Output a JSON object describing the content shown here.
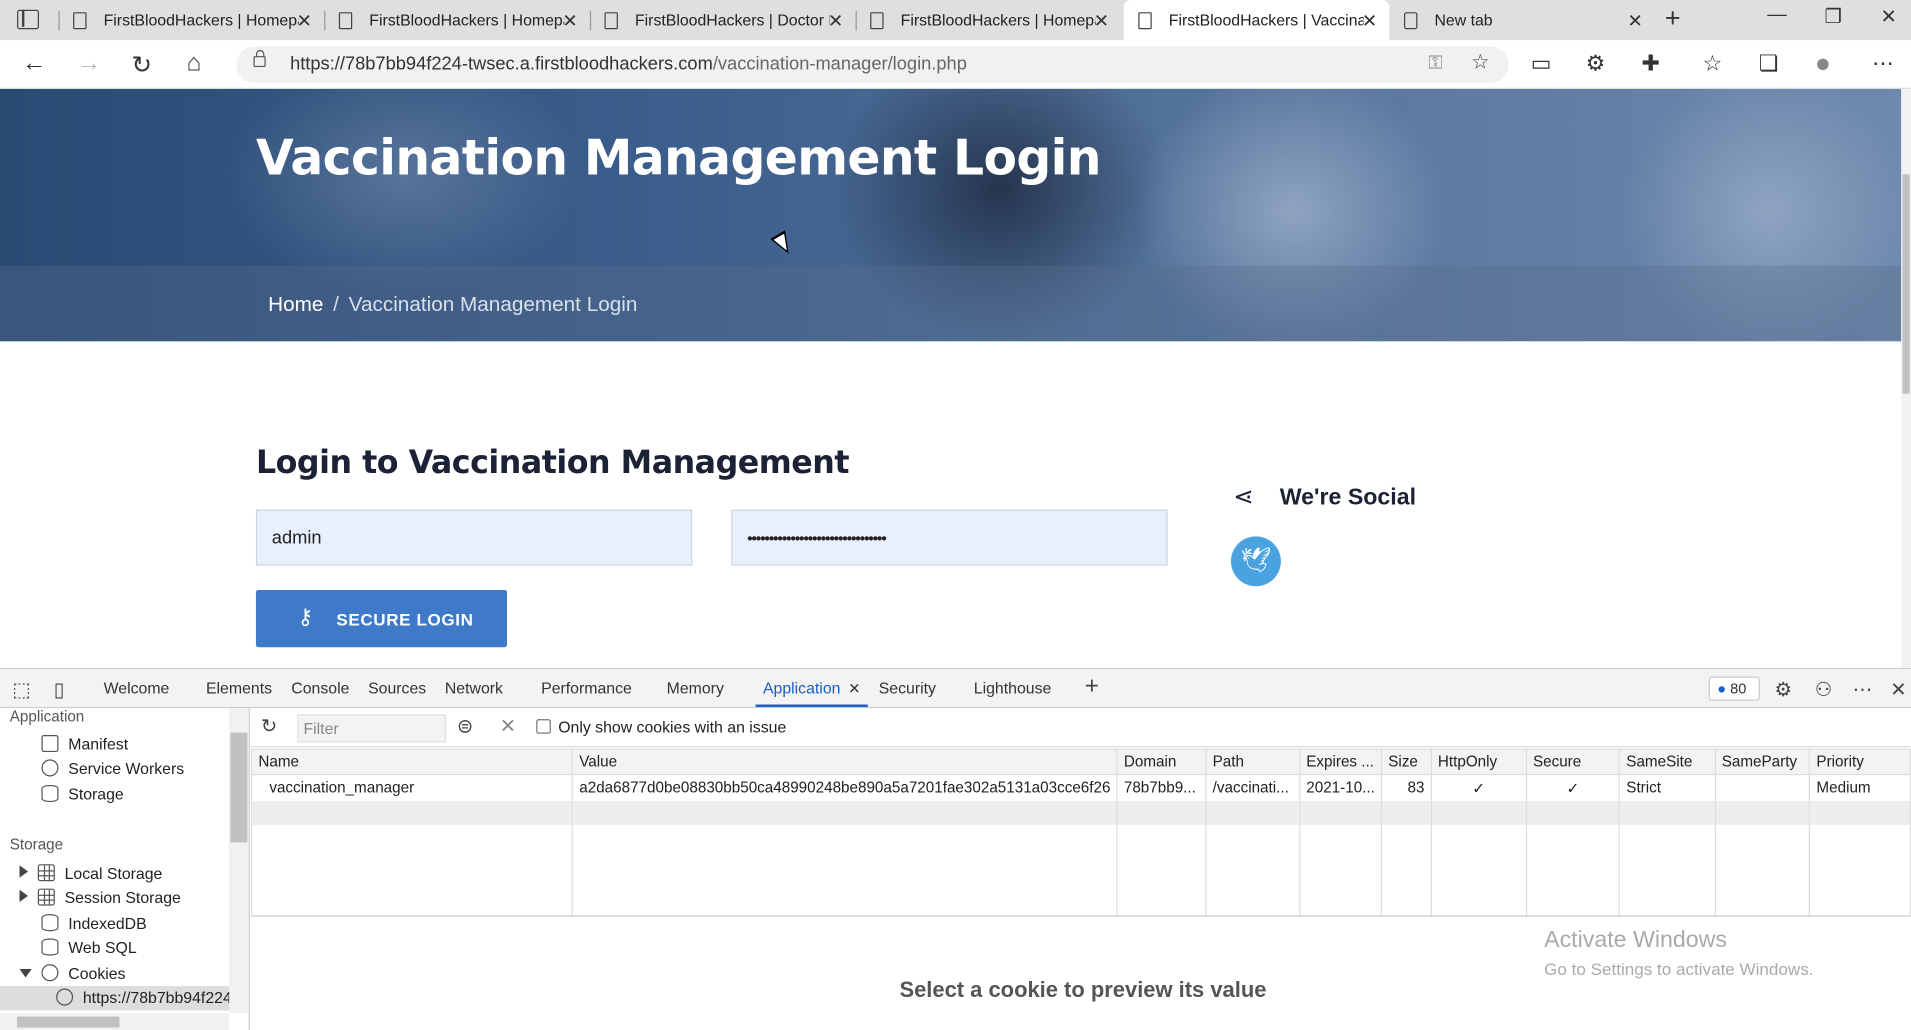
{
  "browser": {
    "tabs": [
      {
        "title": "FirstBloodHackers | Homepage"
      },
      {
        "title": "FirstBloodHackers | Homepage"
      },
      {
        "title": "FirstBloodHackers | Doctor Login"
      },
      {
        "title": "FirstBloodHackers | Homepage"
      },
      {
        "title": "FirstBloodHackers | Vaccination Management Login"
      },
      {
        "title": "New tab"
      }
    ],
    "url_host": "https://78b7bb94f224-twsec.a.firstbloodhackers.com",
    "url_path": "/vaccination-manager/login.php"
  },
  "page": {
    "hero_title": "Vaccination Management Login",
    "breadcrumb_home": "Home",
    "breadcrumb_sep": "/",
    "breadcrumb_current": "Vaccination Management Login",
    "login_heading": "Login to Vaccination Management",
    "username_value": "admin",
    "password_mask": "••••••••••••••••••••••••••••••••",
    "login_button": "SECURE LOGIN",
    "social_heading": "We're Social"
  },
  "devtools": {
    "tabs": [
      "Welcome",
      "Elements",
      "Console",
      "Sources",
      "Network",
      "Performance",
      "Memory",
      "Application",
      "Security",
      "Lighthouse"
    ],
    "active_tab": "Application",
    "issues_count": "80",
    "sidebar": {
      "app_section": "Application",
      "app_items": [
        "Manifest",
        "Service Workers",
        "Storage"
      ],
      "storage_section": "Storage",
      "storage_items": [
        "Local Storage",
        "Session Storage",
        "IndexedDB",
        "Web SQL",
        "Cookies"
      ],
      "cookie_origin": "https://78b7bb94f224"
    },
    "filter_placeholder": "Filter",
    "only_issues_label": "Only show cookies with an issue",
    "columns": [
      "Name",
      "Value",
      "Domain",
      "Path",
      "Expires ...",
      "Size",
      "HttpOnly",
      "Secure",
      "SameSite",
      "SameParty",
      "Priority"
    ],
    "cookie": {
      "name": "vaccination_manager",
      "value": "a2da6877d0be08830bb50ca48990248be890a5a7201fae302a5131a03cce6f26",
      "domain": "78b7bb9...",
      "path": "/vaccinati...",
      "expires": "2021-10...",
      "size": "83",
      "httponly": "✓",
      "secure": "✓",
      "samesite": "Strict",
      "sameparty": "",
      "priority": "Medium"
    },
    "preview_message": "Select a cookie to preview its value"
  },
  "watermark": {
    "line1": "Activate Windows",
    "line2": "Go to Settings to activate Windows."
  }
}
